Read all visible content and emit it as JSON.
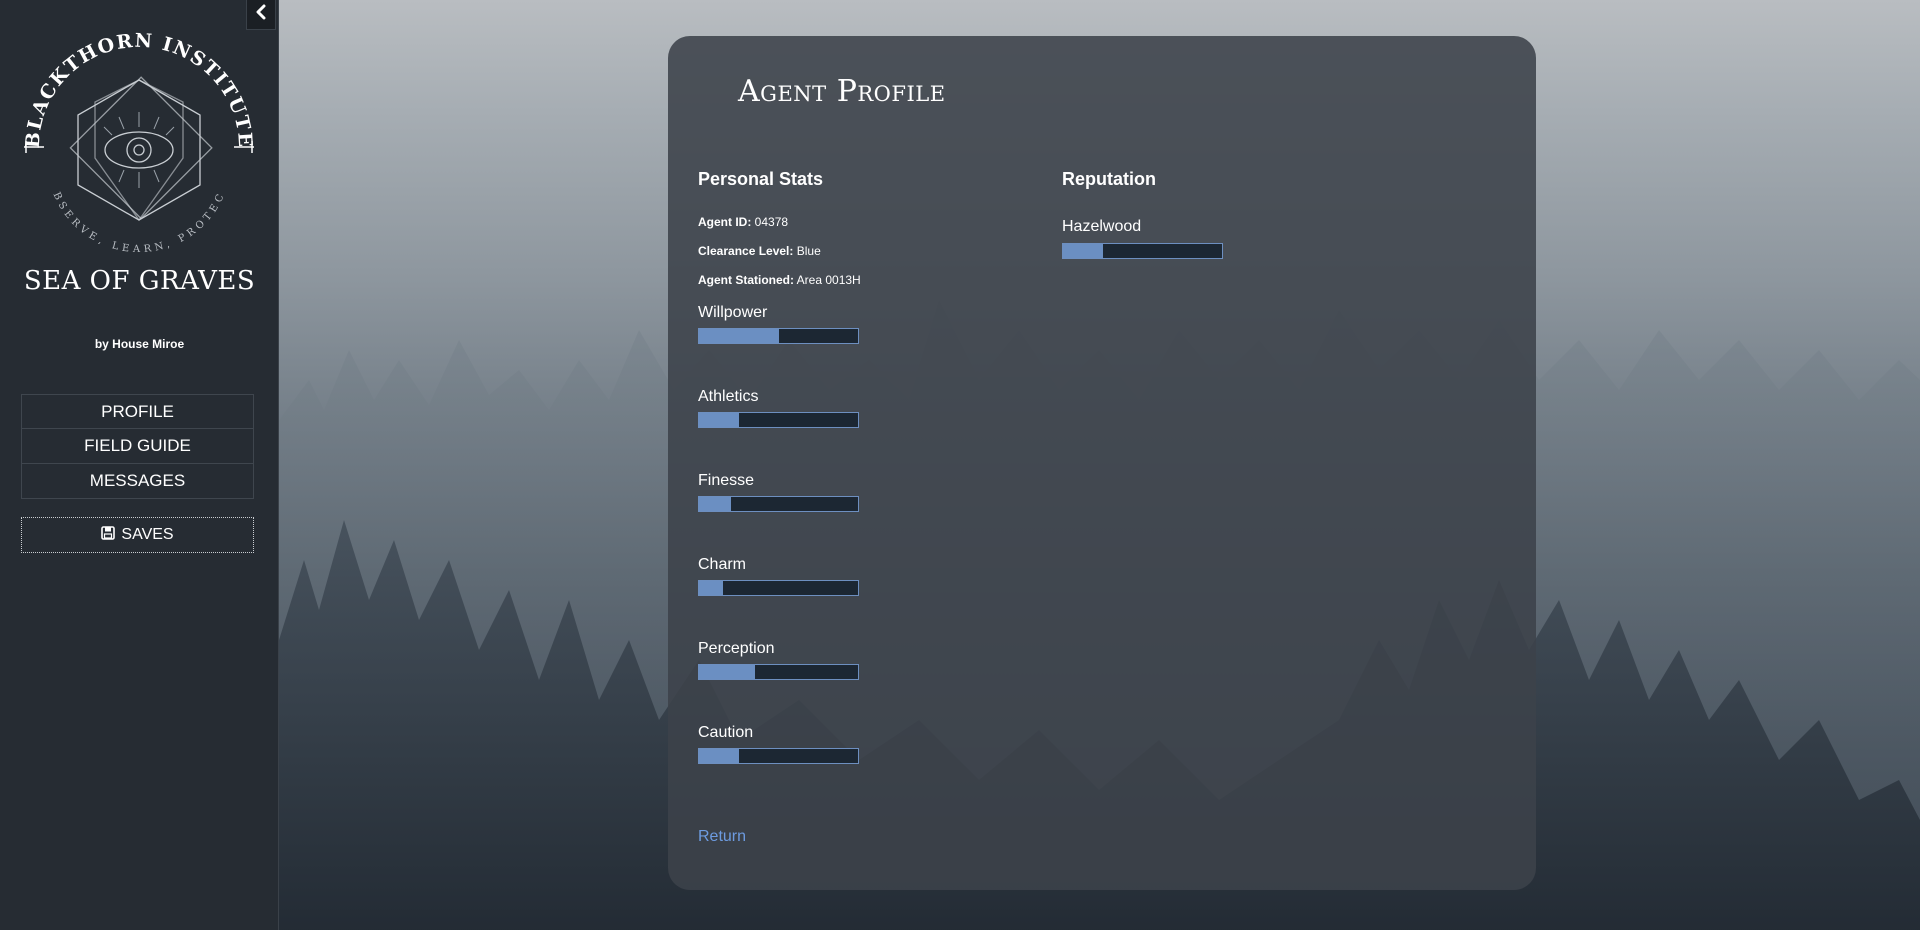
{
  "sidebar": {
    "emblem": {
      "arc_text": "BLACKTHORN INSTITUTE",
      "motto": "OBSERVE, LEARN, PROTECT"
    },
    "game_title": "SEA OF GRAVES",
    "byline": "by House Miroe",
    "nav_items": [
      {
        "label": "PROFILE"
      },
      {
        "label": "FIELD GUIDE"
      },
      {
        "label": "MESSAGES"
      }
    ],
    "saves_label": "SAVES"
  },
  "profile": {
    "title": "Agent Profile",
    "personal_heading": "Personal Stats",
    "info": [
      {
        "key": "Agent ID:",
        "value": "04378"
      },
      {
        "key": "Clearance Level:",
        "value": "Blue"
      },
      {
        "key": "Agent Stationed:",
        "value": "Area 0013H"
      }
    ],
    "stats": [
      {
        "label": "Willpower",
        "fill": 0.5
      },
      {
        "label": "Athletics",
        "fill": 0.25
      },
      {
        "label": "Finesse",
        "fill": 0.2
      },
      {
        "label": "Charm",
        "fill": 0.15
      },
      {
        "label": "Perception",
        "fill": 0.35
      },
      {
        "label": "Caution",
        "fill": 0.25
      }
    ],
    "reputation_heading": "Reputation",
    "reputation": [
      {
        "label": "Hazelwood",
        "fill": 0.25
      }
    ],
    "return_label": "Return"
  },
  "colors": {
    "bar_fill": "#6b8fc2",
    "bar_track": "#1c2733",
    "link": "#6d9be0",
    "sidebar_bg": "#262c33"
  }
}
